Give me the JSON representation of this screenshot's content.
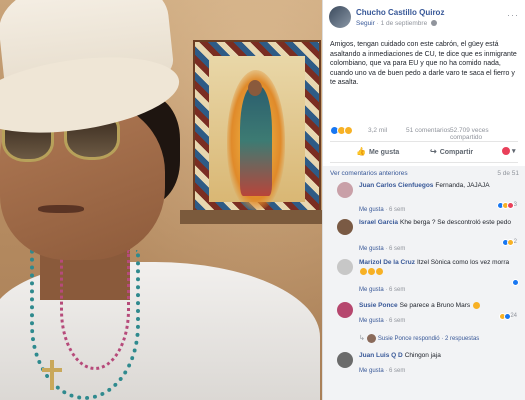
{
  "post": {
    "author": "Chucho Castillo Quiroz",
    "follow_label": "Seguir",
    "separator": " · ",
    "date": "1 de septiembre",
    "more_label": "···",
    "text": "Amigos, tengan cuidado con este cabrón, el güey está asaltando a inmediaciones de CU, te dice que es inmigrante colombiano, que va para EU y que no ha comido nada, cuando uno va de buen pedo a darle varo te saca el fierro y te asalta."
  },
  "stats": {
    "reactions": "3,2 mil",
    "comments": "51 comentarios",
    "views": "52.709 veces compartido"
  },
  "actions": {
    "like_label": "Me gusta",
    "share_label": "Compartir",
    "like_icon": "thumbs-up-icon",
    "share_icon": "share-arrow-icon"
  },
  "comments_header": {
    "prev_label": "Ver comentarios anteriores",
    "count": "5 de 51"
  },
  "comments": [
    {
      "name": "Juan Carlos Cienfuegos",
      "text": "Fernanda, JAJAJA",
      "like": "Me gusta",
      "time": "6 sem",
      "reactions": "3",
      "avatar_color": "#c9a0a8"
    },
    {
      "name": "Israel Garcia",
      "text": "Khe berga ? Se descontroló este pedo",
      "like": "Me gusta",
      "time": "6 sem",
      "reactions": "2",
      "avatar_color": "#7a5a44"
    },
    {
      "name": "Marizol De la Cruz",
      "text": "Itzel Sònica como los vez morra",
      "like": "Me gusta",
      "time": "6 sem",
      "reactions": "",
      "avatar_color": "#c7c7c7"
    },
    {
      "name": "Susie Ponce",
      "text": "Se parece a Bruno Mars",
      "like": "Me gusta",
      "time": "6 sem",
      "reactions": "24",
      "avatar_color": "#b6476e"
    },
    {
      "name": "Juan Luis Q D",
      "text": "Chingon jaja",
      "like": "Me gusta",
      "time": "6 sem",
      "reactions": "",
      "avatar_color": "#6b6b6b"
    }
  ],
  "reply": {
    "text": "Susie Ponce respondió",
    "separator": " · ",
    "count": "2 respuestas"
  },
  "colors": {
    "link": "#385898",
    "meta": "#90949c",
    "like": "#1877f2",
    "love": "#e9405a",
    "haha": "#f7b125"
  }
}
